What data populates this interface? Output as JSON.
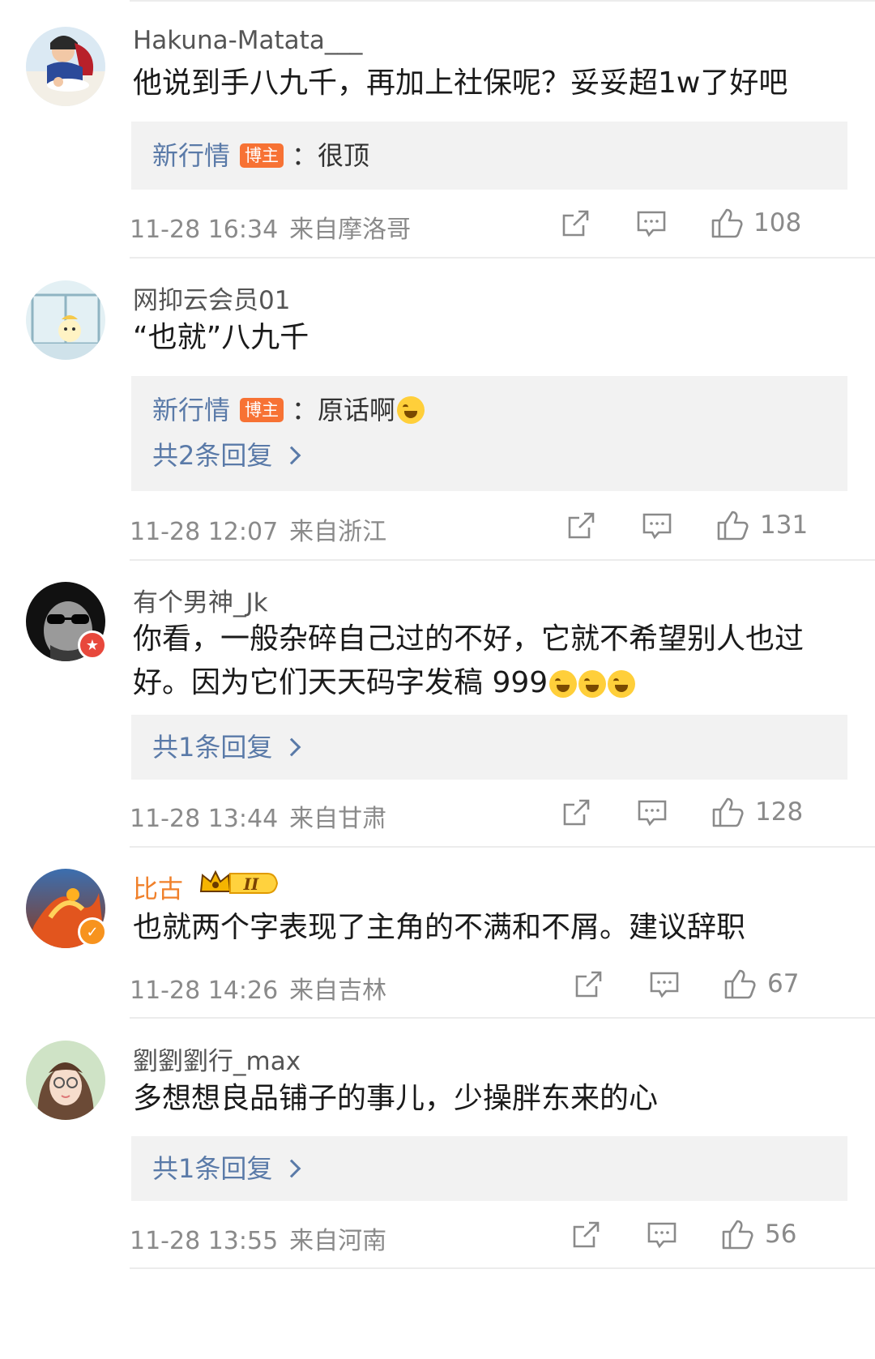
{
  "host_tag": "博主",
  "comments": [
    {
      "username": "Hakuna-Matata___",
      "content": "他说到手八九千，再加上社保呢？妥妥超1w了好吧",
      "reply": {
        "author": "新行情",
        "text": "：很顶"
      },
      "more_replies": "",
      "time": "11-28 16:34",
      "location": "来自摩洛哥",
      "likes": "108"
    },
    {
      "username": "网抑云会员01",
      "content": "“也就”八九千",
      "reply": {
        "author": "新行情",
        "text": "：原话啊"
      },
      "more_replies": "共2条回复",
      "time": "11-28 12:07",
      "location": "来自浙江",
      "likes": "131"
    },
    {
      "username": "有个男神_Jk",
      "content": "你看，一般杂碎自己过的不好，它就不希望别人也过好。因为它们天天码字发稿 999",
      "more_replies": "共1条回复",
      "time": "11-28 13:44",
      "location": "来自甘肃",
      "likes": "128"
    },
    {
      "username": "比古",
      "vip_level": "II",
      "content": "也就两个字表现了主角的不满和不屑。建议辞职",
      "time": "11-28 14:26",
      "location": "来自吉林",
      "likes": "67"
    },
    {
      "username": "劉劉劉行_max",
      "content": "多想想良品铺子的事儿，少操胖东来的心",
      "more_replies": "共1条回复",
      "time": "11-28 13:55",
      "location": "来自河南",
      "likes": "56"
    }
  ],
  "colors": {
    "link": "#5a7aa8",
    "host_tag": "#f77234",
    "vip_name": "#f0802a",
    "meta": "#8a8a8a",
    "reply_bg": "#f2f2f2"
  }
}
